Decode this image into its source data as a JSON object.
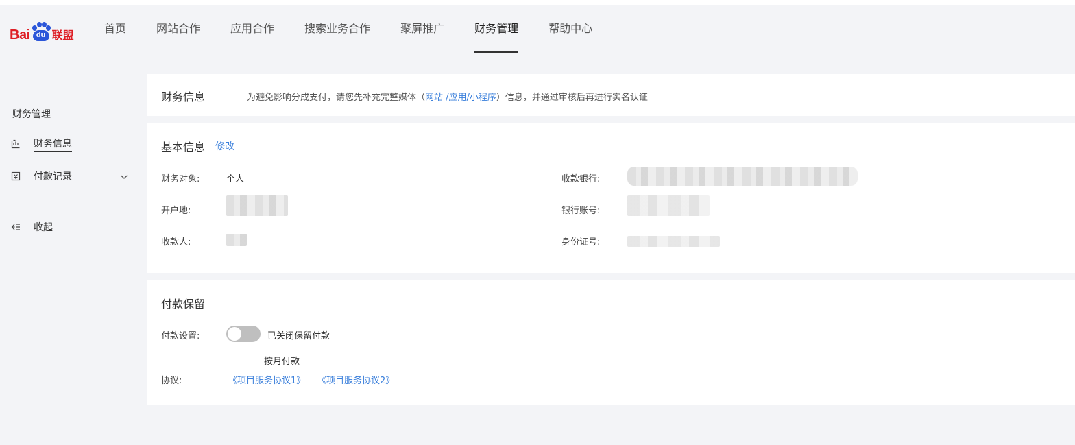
{
  "header": {
    "logo": {
      "bai": "Bai",
      "du": "du",
      "lianmeng": "联盟"
    },
    "nav": [
      {
        "label": "首页"
      },
      {
        "label": "网站合作"
      },
      {
        "label": "应用合作"
      },
      {
        "label": "搜索业务合作"
      },
      {
        "label": "聚屏推广"
      },
      {
        "label": "财务管理",
        "active": true
      },
      {
        "label": "帮助中心"
      }
    ]
  },
  "sidebar": {
    "group_title": "财务管理",
    "items": [
      {
        "label": "财务信息",
        "icon": "finance-info-icon",
        "active": true
      },
      {
        "label": "付款记录",
        "icon": "payment-record-icon",
        "expandable": true
      }
    ],
    "collapse_label": "收起"
  },
  "notice": {
    "title": "财务信息",
    "text_before": "为避免影响分成支付，请您先补充完整媒体（",
    "link_text": "网站 /应用/小程序",
    "text_after": "）信息，并通过审核后再进行实名认证"
  },
  "basic_info": {
    "title": "基本信息",
    "edit_label": "修改",
    "fields": {
      "finance_object": {
        "label": "财务对象:",
        "value": "个人"
      },
      "open_location": {
        "label": "开户地:"
      },
      "payee": {
        "label": "收款人:"
      },
      "bank": {
        "label": "收款银行:"
      },
      "account": {
        "label": "银行账号:"
      },
      "id_number": {
        "label": "身份证号:"
      }
    }
  },
  "payment_hold": {
    "title": "付款保留",
    "setting_label": "付款设置:",
    "toggle_on": false,
    "toggle_text": "已关闭保留付款",
    "monthly_label": "按月付款",
    "agreement_label": "协议:",
    "agreements": [
      "《项目服务协议1》",
      "《项目服务协议2》"
    ]
  },
  "colors": {
    "accent": "#3a7fdb",
    "brand_red": "#de1f26",
    "brand_blue": "#2b56d9"
  }
}
